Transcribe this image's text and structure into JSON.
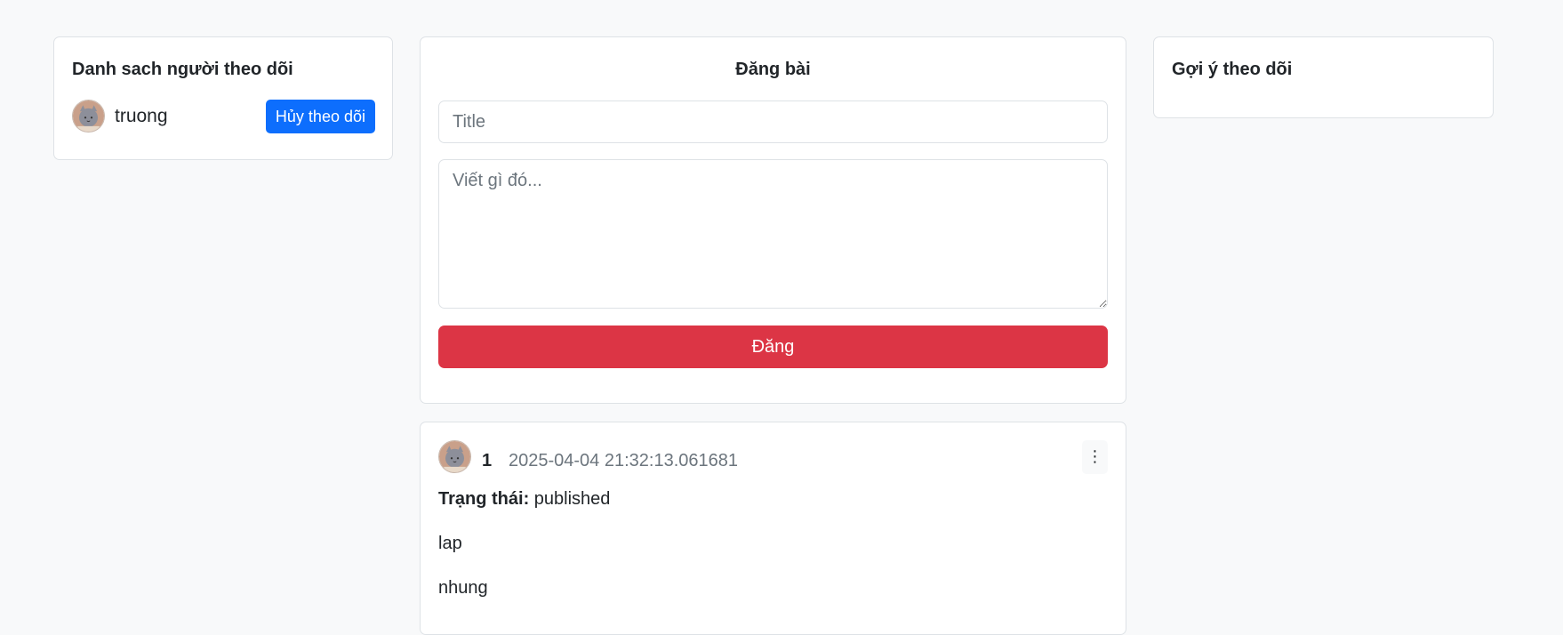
{
  "following": {
    "title": "Danh sach người theo dõi",
    "items": [
      {
        "name": "truong",
        "action_label": "Hủy theo dõi"
      }
    ]
  },
  "composer": {
    "title": "Đăng bài",
    "title_placeholder": "Title",
    "body_placeholder": "Viết gì đó...",
    "submit_label": "Đăng"
  },
  "suggestions": {
    "title": "Gợi ý theo dõi"
  },
  "post": {
    "author": "1",
    "timestamp": "2025-04-04 21:32:13.061681",
    "more_icon": "⋮",
    "status_label": "Trạng thái:",
    "status_value": "published",
    "title": "lap",
    "content": "nhung"
  },
  "colors": {
    "primary": "#0d6efd",
    "danger": "#dc3545",
    "background": "#f8f9fa"
  }
}
